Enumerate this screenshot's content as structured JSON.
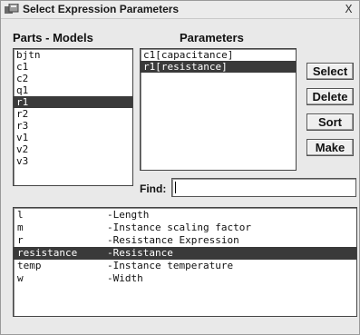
{
  "window": {
    "title": "Select Expression Parameters",
    "close_glyph": "X"
  },
  "parts_models": {
    "header": "Parts - Models",
    "items": [
      "bjtn",
      "c1",
      "c2",
      "q1",
      "r1",
      "r2",
      "r3",
      "v1",
      "v2",
      "v3"
    ],
    "selected_index": 4
  },
  "parameters": {
    "header": "Parameters",
    "items": [
      "c1[capacitance]",
      "r1[resistance]"
    ],
    "selected_index": 1
  },
  "buttons": {
    "select": "Select",
    "delete": "Delete",
    "sort": "Sort",
    "make": "Make"
  },
  "find": {
    "label": "Find:",
    "value": ""
  },
  "param_table": {
    "rows": [
      {
        "name": "l",
        "desc": "-Length"
      },
      {
        "name": "m",
        "desc": "-Instance scaling factor"
      },
      {
        "name": "r",
        "desc": "-Resistance Expression"
      },
      {
        "name": "resistance",
        "desc": "-Resistance"
      },
      {
        "name": "temp",
        "desc": "-Instance temperature"
      },
      {
        "name": "w",
        "desc": "-Width"
      }
    ],
    "selected_index": 3
  },
  "colors": {
    "selection": "#3a3a3a",
    "window_bg": "#e9e9e9"
  }
}
